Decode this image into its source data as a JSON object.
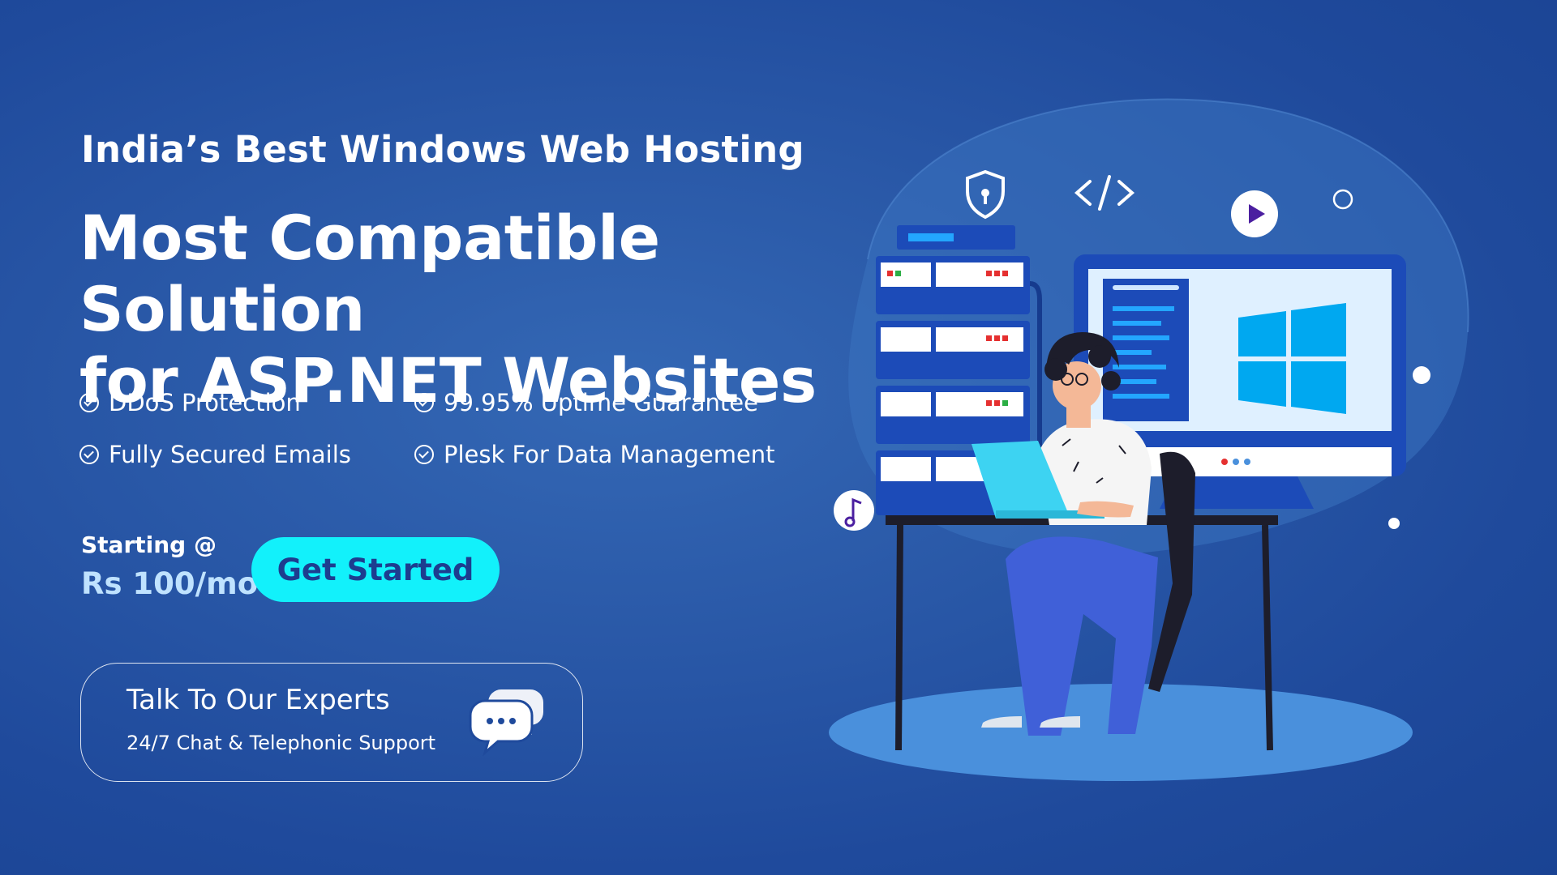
{
  "hero": {
    "eyebrow": "India’s Best Windows Web Hosting",
    "headline_line1": "Most Compatible Solution",
    "headline_line2": "for ASP.NET Websites"
  },
  "features": [
    "DDoS Protection",
    "99.95% Uptime Guarantee",
    "Fully Secured Emails",
    "Plesk For Data Management"
  ],
  "pricing": {
    "label": "Starting @",
    "value": "Rs 100/mo"
  },
  "cta": {
    "label": "Get Started"
  },
  "support": {
    "title": "Talk To Our Experts",
    "subtitle": "24/7 Chat & Telephonic Support"
  },
  "icons": {
    "check": "check-circle-icon",
    "chat": "chat-bubbles-icon",
    "shield": "shield-lock-icon",
    "code": "code-brackets-icon",
    "play": "play-icon",
    "music": "music-note-icon",
    "windows": "windows-logo-icon"
  },
  "colors": {
    "background": "#1f4a9c",
    "cta_background": "#12f1fb",
    "cta_text": "#1d3d8f",
    "price_value": "#bfe2ff"
  }
}
